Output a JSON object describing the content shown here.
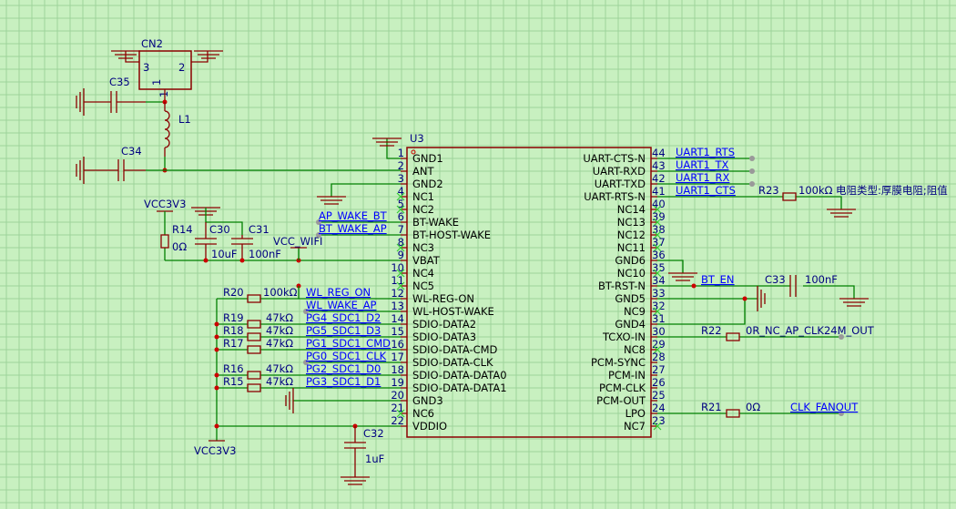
{
  "u3": {
    "designator": "U3",
    "left_pins": [
      {
        "num": "1",
        "name": "GND1"
      },
      {
        "num": "2",
        "name": "ANT"
      },
      {
        "num": "3",
        "name": "GND2"
      },
      {
        "num": "4",
        "name": "NC1"
      },
      {
        "num": "5",
        "name": "NC2"
      },
      {
        "num": "6",
        "name": "BT-WAKE"
      },
      {
        "num": "7",
        "name": "BT-HOST-WAKE"
      },
      {
        "num": "8",
        "name": "NC3"
      },
      {
        "num": "9",
        "name": "VBAT"
      },
      {
        "num": "10",
        "name": "NC4"
      },
      {
        "num": "11",
        "name": "NC5"
      },
      {
        "num": "12",
        "name": "WL-REG-ON"
      },
      {
        "num": "13",
        "name": "WL-HOST-WAKE"
      },
      {
        "num": "14",
        "name": "SDIO-DATA2"
      },
      {
        "num": "15",
        "name": "SDIO-DATA3"
      },
      {
        "num": "16",
        "name": "SDIO-DATA-CMD"
      },
      {
        "num": "17",
        "name": "SDIO-DATA-CLK"
      },
      {
        "num": "18",
        "name": "SDIO-DATA-DATA0"
      },
      {
        "num": "19",
        "name": "SDIO-DATA-DATA1"
      },
      {
        "num": "20",
        "name": "GND3"
      },
      {
        "num": "21",
        "name": "NC6"
      },
      {
        "num": "22",
        "name": "VDDIO"
      }
    ],
    "right_pins": [
      {
        "num": "44",
        "name": "UART-CTS-N"
      },
      {
        "num": "43",
        "name": "UART-RXD"
      },
      {
        "num": "42",
        "name": "UART-TXD"
      },
      {
        "num": "41",
        "name": "UART-RTS-N"
      },
      {
        "num": "40",
        "name": "NC14"
      },
      {
        "num": "39",
        "name": "NC13"
      },
      {
        "num": "38",
        "name": "NC12"
      },
      {
        "num": "37",
        "name": "NC11"
      },
      {
        "num": "36",
        "name": "GND6"
      },
      {
        "num": "35",
        "name": "NC10"
      },
      {
        "num": "34",
        "name": "BT-RST-N"
      },
      {
        "num": "33",
        "name": "GND5"
      },
      {
        "num": "32",
        "name": "NC9"
      },
      {
        "num": "31",
        "name": "GND4"
      },
      {
        "num": "30",
        "name": "TCXO-IN"
      },
      {
        "num": "29",
        "name": "NC8"
      },
      {
        "num": "28",
        "name": "PCM-SYNC"
      },
      {
        "num": "27",
        "name": "PCM-IN"
      },
      {
        "num": "26",
        "name": "PCM-CLK"
      },
      {
        "num": "25",
        "name": "PCM-OUT"
      },
      {
        "num": "24",
        "name": "LPO"
      },
      {
        "num": "23",
        "name": "NC7"
      }
    ]
  },
  "cn2": {
    "designator": "CN2",
    "pin3": "3",
    "pin2": "2",
    "pin1": "1",
    "pin1b": "1"
  },
  "components": {
    "c35": "C35",
    "c34": "C34",
    "l1": "L1",
    "c30": "C30",
    "c30_val": "10uF",
    "c31": "C31",
    "c31_val": "100nF",
    "r14": "R14",
    "r14_val": "0Ω",
    "r20": "R20",
    "r20_val": "100kΩ",
    "r19": "R19",
    "r19_val": "47kΩ",
    "r18": "R18",
    "r18_val": "47kΩ",
    "r17": "R17",
    "r17_val": "47kΩ",
    "r16": "R16",
    "r16_val": "47kΩ",
    "r15": "R15",
    "r15_val": "47kΩ",
    "c32": "C32",
    "c32_val": "1uF",
    "r23": "R23",
    "r23_val": "100kΩ 电阻类型:厚膜电阻;阻值",
    "c33": "C33",
    "c33_val": "100nF",
    "r22": "R22",
    "r22_val": "0R_NC_AP_CLK24M_OUT",
    "r21": "R21",
    "r21_val": "0Ω"
  },
  "power": {
    "vcc3v3_top": "VCC3V3",
    "vcc_wifi": "VCC_WIFI",
    "vcc3v3_bottom": "VCC3V3"
  },
  "nets": {
    "ap_wake_bt": "AP_WAKE_BT",
    "bt_wake_ap": "BT_WAKE_AP",
    "wl_reg_on": "WL_REG_ON",
    "wl_wake_ap": "WL_WAKE_AP",
    "pg4": "PG4_SDC1_D2",
    "pg5": "PG5_SDC1_D3",
    "pg1": "PG1_SDC1_CMD",
    "pg0": "PG0_SDC1_CLK",
    "pg2": "PG2_SDC1_D0",
    "pg3": "PG3_SDC1_D1",
    "uart1_rts": "UART1_RTS",
    "uart1_tx": "UART1_TX",
    "uart1_rx": "UART1_RX",
    "uart1_cts": "UART1_CTS",
    "bt_en": "BT_EN",
    "clk_fanout": "CLK_FANOUT"
  }
}
